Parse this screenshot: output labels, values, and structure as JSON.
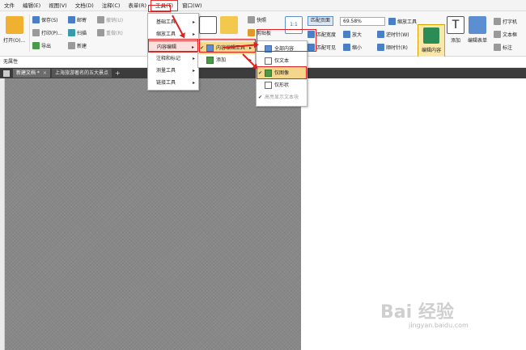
{
  "menubar": [
    "文件",
    "编辑(E)",
    "视图(V)",
    "文档(D)",
    "注释(C)",
    "表单(R)",
    "工具(T)",
    "窗口(W)"
  ],
  "ribbon": {
    "open": "打开(O)...",
    "save": "保存(S)",
    "print": "打印(P)...",
    "export": "导出",
    "email": "邮寄",
    "scan": "扫描",
    "new": "新建",
    "undo": "撤销(U)",
    "redo": "重做(R)",
    "snapshot": "快照",
    "clipboard": "剪贴板",
    "fit_page": "匹配页面",
    "zoom": "69.58%",
    "fit_width": "匹配宽度",
    "fit_visible": "匹配可见",
    "zoom_tool": "缩放工具",
    "zoom_in": "放大",
    "zoom_out": "缩小",
    "rotate_ccw": "逆时针(W)",
    "rotate_cw": "顺时针(R)",
    "edit_content": "编辑内容",
    "add": "添加",
    "edit_form": "编辑表单",
    "typewriter": "打字机",
    "textbox": "文本框",
    "annotate": "标注"
  },
  "property_bar": "无属性",
  "tabs": [
    "新建文档 *",
    "上海旅游著名的五大景点"
  ],
  "tools_menu": {
    "items": [
      "基础工具",
      "缩放工具",
      "内容编辑",
      "注释和标记",
      "测量工具",
      "链接工具"
    ]
  },
  "content_edit_menu": {
    "items": [
      "内容编辑工具",
      "添加"
    ]
  },
  "content_type_menu": {
    "items": [
      "全部内容",
      "仅文本",
      "仅图像",
      "仅形状",
      "高亮显示文本块"
    ]
  },
  "watermark": {
    "logo": "Bai 经验",
    "url": "jingyan.baidu.com"
  },
  "colors": {
    "highlight_red": "#e02020",
    "doc_gray": "#888888",
    "tab_bar": "#3c3c3c"
  }
}
